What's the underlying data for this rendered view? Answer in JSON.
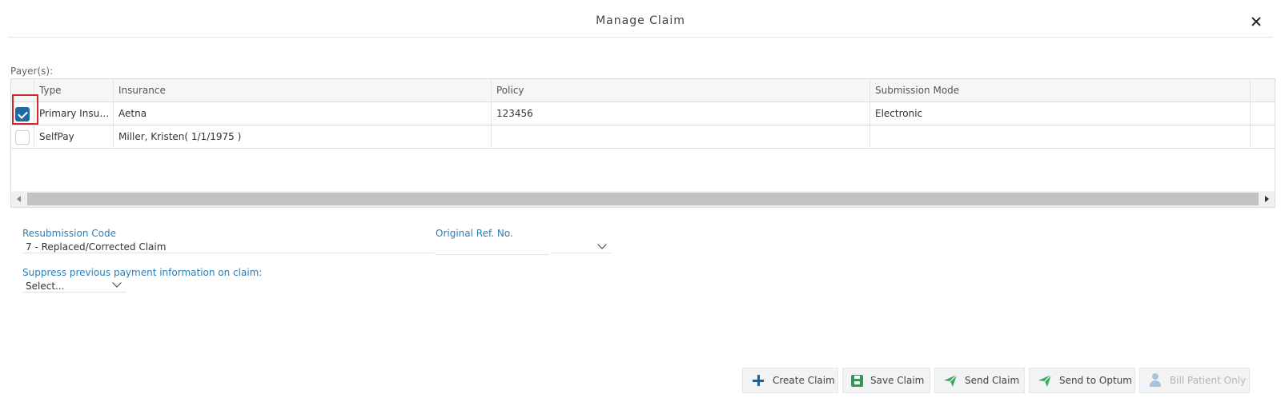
{
  "dialog": {
    "title": "Manage Claim",
    "close_icon": "close-icon"
  },
  "payers": {
    "label": "Payer(s):",
    "columns": [
      "Type",
      "Insurance",
      "Policy",
      "Submission Mode"
    ],
    "rows": [
      {
        "selected": true,
        "type": "Primary Insura...",
        "insurance": "Aetna",
        "policy": "123456",
        "submission_mode": "Electronic"
      },
      {
        "selected": false,
        "type": "SelfPay",
        "insurance": "Miller, Kristen( 1/1/1975 )",
        "policy": "",
        "submission_mode": ""
      }
    ],
    "highlight_color": "#d9232e"
  },
  "form": {
    "resubmission_code": {
      "label": "Resubmission Code",
      "value": "7 - Replaced/Corrected Claim"
    },
    "original_ref_no": {
      "label": "Original Ref. No.",
      "value": ""
    },
    "suppress_payment": {
      "label": "Suppress previous payment information on claim:",
      "value": "Select..."
    }
  },
  "actions": {
    "create_claim": {
      "label": "Create Claim",
      "icon": "plus-icon",
      "color": "#1e5f94"
    },
    "save_claim": {
      "label": "Save Claim",
      "icon": "floppy-disk-icon",
      "color": "#2f9a55"
    },
    "send_claim": {
      "label": "Send Claim",
      "icon": "paper-plane-icon",
      "color": "#3aa65a"
    },
    "send_to_optum": {
      "label": "Send to Optum",
      "icon": "paper-plane-icon",
      "color": "#3aa65a"
    },
    "bill_patient_only": {
      "label": "Bill Patient Only",
      "icon": "person-icon",
      "disabled": true
    }
  },
  "theme": {
    "accent": "#1e6aa3",
    "label_color": "#2a7fb8"
  }
}
